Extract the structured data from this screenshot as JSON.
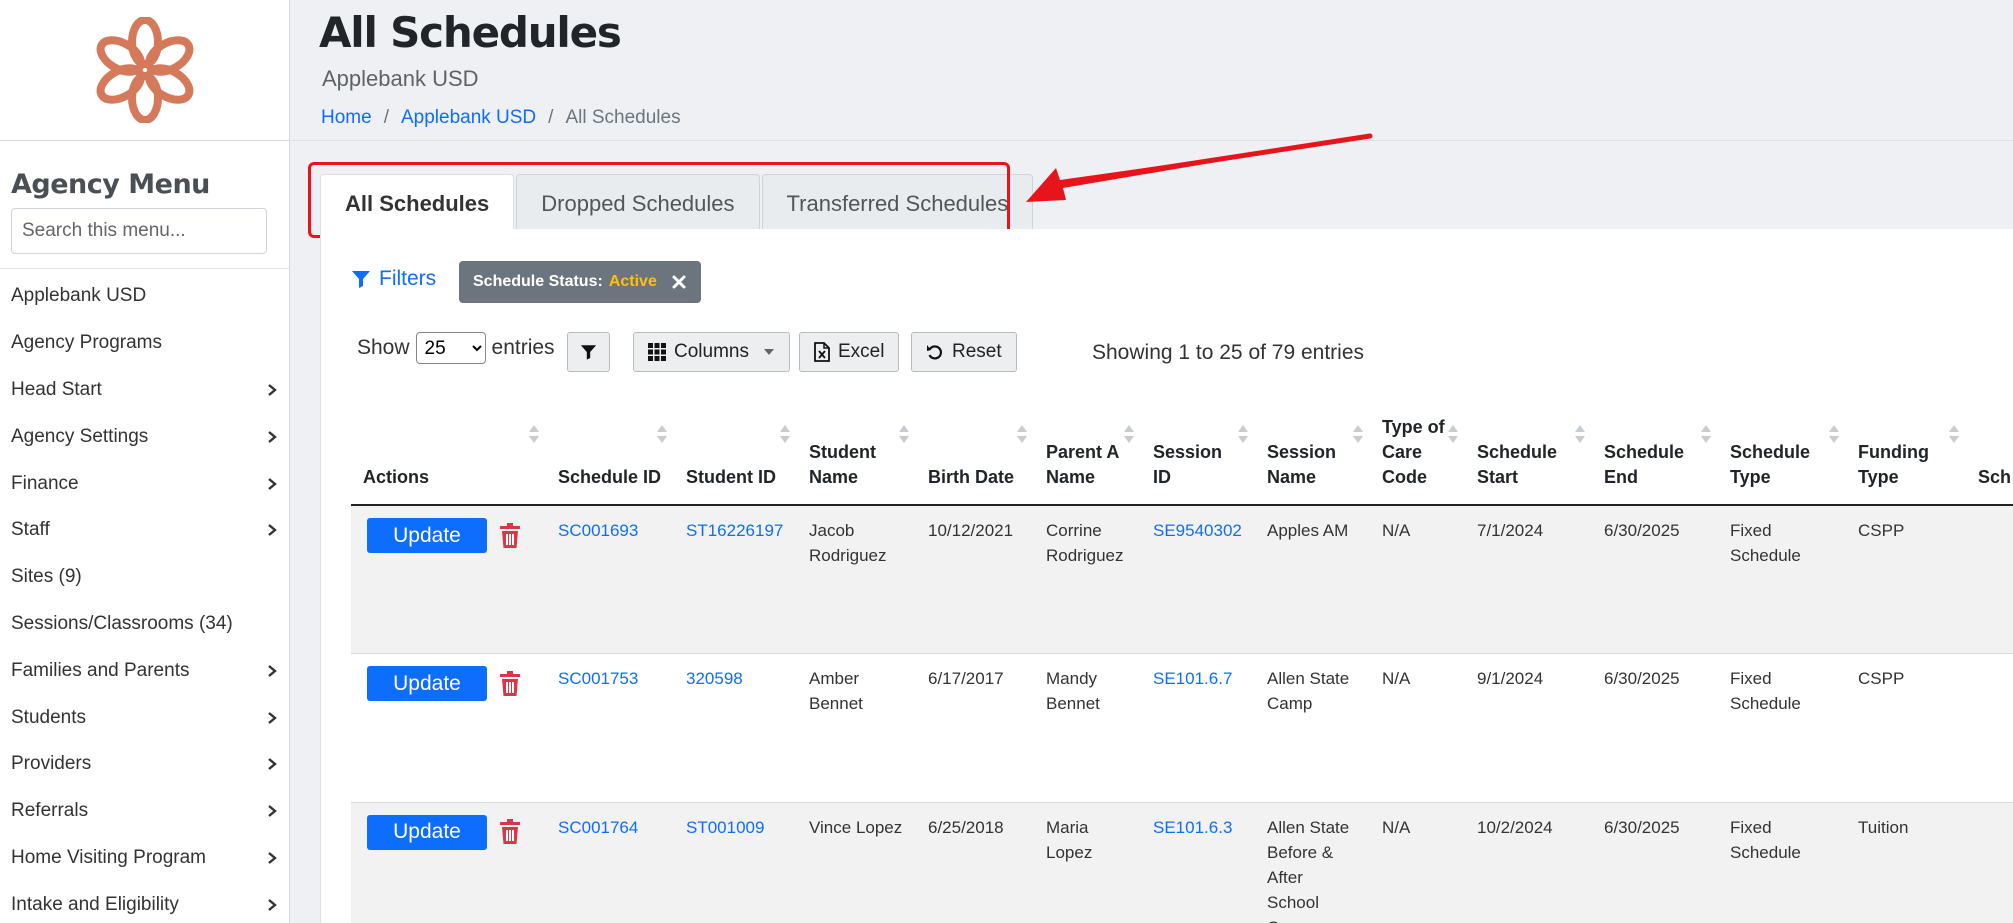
{
  "sidebar": {
    "menu_title": "Agency Menu",
    "search_placeholder": "Search this menu...",
    "items": [
      {
        "label": "Applebank USD",
        "has_children": false
      },
      {
        "label": "Agency Programs",
        "has_children": false
      },
      {
        "label": "Head Start",
        "has_children": true
      },
      {
        "label": "Agency Settings",
        "has_children": true
      },
      {
        "label": "Finance",
        "has_children": true
      },
      {
        "label": "Staff",
        "has_children": true
      },
      {
        "label": "Sites (9)",
        "has_children": false
      },
      {
        "label": "Sessions/Classrooms (34)",
        "has_children": false
      },
      {
        "label": "Families and Parents",
        "has_children": true
      },
      {
        "label": "Students",
        "has_children": true
      },
      {
        "label": "Providers",
        "has_children": true
      },
      {
        "label": "Referrals",
        "has_children": true
      },
      {
        "label": "Home Visiting Program",
        "has_children": true
      },
      {
        "label": "Intake and Eligibility",
        "has_children": true
      }
    ]
  },
  "header": {
    "title": "All Schedules",
    "subtitle": "Applebank USD",
    "breadcrumb": [
      {
        "label": "Home"
      },
      {
        "label": "Applebank USD"
      },
      {
        "label": "All Schedules"
      }
    ],
    "breadcrumb_separator": "/"
  },
  "tabs": [
    {
      "label": "All Schedules",
      "active": true
    },
    {
      "label": "Dropped Schedules",
      "active": false
    },
    {
      "label": "Transferred Schedules",
      "active": false
    }
  ],
  "filters": {
    "link_label": "Filters",
    "chip_key": "Schedule Status:",
    "chip_value": "Active"
  },
  "toolbar": {
    "show_label": "Show",
    "entries_value": "25",
    "entries_label": "entries",
    "columns_label": "Columns",
    "excel_label": "Excel",
    "reset_label": "Reset",
    "showing_info": "Showing 1 to 25 of 79 entries"
  },
  "table": {
    "columns": [
      "Actions",
      "Schedule ID",
      "Student ID",
      "Student Name",
      "Birth Date",
      "Parent A Name",
      "Session ID",
      "Session Name",
      "Type of Care Code",
      "Schedule Start",
      "Schedule End",
      "Schedule Type",
      "Funding Type",
      "Sch Day Mo"
    ],
    "update_label": "Update",
    "rows": [
      {
        "schedule_id": "SC001693",
        "student_id": "ST16226197",
        "student_name": "Jacob Rodriguez",
        "birth_date": "10/12/2021",
        "parent_a_name": "Corrine Rodriguez",
        "session_id": "SE9540302",
        "session_name": "Apples AM",
        "type_of_care_code": "N/A",
        "schedule_start": "7/1/2024",
        "schedule_end": "6/30/2025",
        "schedule_type": "Fixed Schedule",
        "funding_type": "CSPP"
      },
      {
        "schedule_id": "SC001753",
        "student_id": "320598",
        "student_name": "Amber Bennet",
        "birth_date": "6/17/2017",
        "parent_a_name": "Mandy Bennet",
        "session_id": "SE101.6.7",
        "session_name": "Allen State Camp",
        "type_of_care_code": "N/A",
        "schedule_start": "9/1/2024",
        "schedule_end": "6/30/2025",
        "schedule_type": "Fixed Schedule",
        "funding_type": "CSPP"
      },
      {
        "schedule_id": "SC001764",
        "student_id": "ST001009",
        "student_name": "Vince Lopez",
        "birth_date": "6/25/2018",
        "parent_a_name": "Maria Lopez",
        "session_id": "SE101.6.3",
        "session_name": "Allen State Before & After School Camp",
        "type_of_care_code": "N/A",
        "schedule_start": "10/2/2024",
        "schedule_end": "6/30/2025",
        "schedule_type": "Fixed Schedule",
        "funding_type": "Tuition"
      }
    ]
  },
  "colors": {
    "link": "#0d6efd",
    "annotation": "#e8141c",
    "logo": "#d4795a",
    "chip_bg": "#6c757d",
    "chip_value": "#ffc107",
    "trash": "#dc3545"
  }
}
